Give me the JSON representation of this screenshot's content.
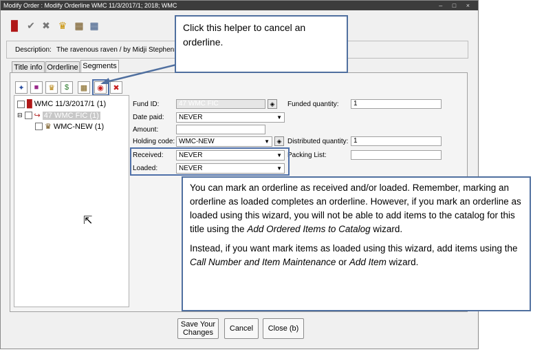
{
  "window": {
    "title": "Modify Order : Modify Orderline  WMC 11/3/2017/1; 2018; WMC",
    "controls": "– □ ×"
  },
  "description": {
    "label": "Description:",
    "value": "The ravenous raven / by Midji Stephenso"
  },
  "tabs": [
    "Title info",
    "Orderline",
    "Segments"
  ],
  "tree": {
    "root": "WMC 11/3/2017/1 (1)",
    "fund": "47 WMC FIC (1)",
    "holding": "WMC-NEW (1)"
  },
  "form": {
    "fund_id_label": "Fund ID:",
    "fund_id_value": "47 WMC FIC",
    "funded_qty_label": "Funded quantity:",
    "funded_qty_value": "1",
    "date_paid_label": "Date paid:",
    "date_paid_value": "NEVER",
    "amount_label": "Amount:",
    "amount_value": "",
    "holding_code_label": "Holding code:",
    "holding_code_value": "WMC-NEW",
    "distributed_qty_label": "Distributed quantity:",
    "distributed_qty_value": "1",
    "received_label": "Received:",
    "received_value": "NEVER",
    "packing_list_label": "Packing List:",
    "packing_list_value": "",
    "loaded_label": "Loaded:",
    "loaded_value": "NEVER"
  },
  "buttons": {
    "save": "Save Your Changes",
    "cancel": "Cancel",
    "close": "Close (b)"
  },
  "callouts": {
    "top": "Click this helper to cancel an orderline.",
    "bottom_p1_a": "You can mark an orderline as received and/or loaded. Remember, marking an orderline as loaded completes an orderline. However, if you mark an orderline as loaded using this wizard, you will not be able to add items to the catalog for this title using the ",
    "bottom_p1_em": "Add Ordered Items to Catalog",
    "bottom_p1_b": " wizard.",
    "bottom_p2_a": "Instead, if you want mark items as loaded using this wizard, add items using the ",
    "bottom_p2_em1": "Call Number and Item Maintenance",
    "bottom_p2_mid": " or ",
    "bottom_p2_em2": "Add Item",
    "bottom_p2_b": " wizard."
  },
  "colors": {
    "callout_border": "#4f6f9f",
    "titlebar": "#3c3c3c"
  }
}
